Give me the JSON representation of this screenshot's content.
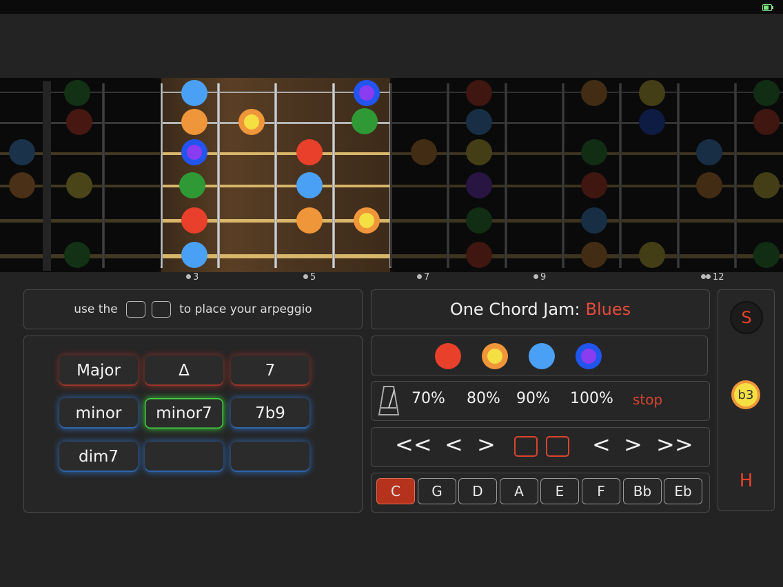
{
  "fret_numbers": [
    "3",
    "5",
    "7",
    "9",
    "12"
  ],
  "hint": {
    "prefix": "use the",
    "suffix": "to place your arpeggio"
  },
  "jam": {
    "title": "One Chord Jam:",
    "style": "Blues"
  },
  "chords": [
    "Major",
    "Δ",
    "7",
    "minor",
    "minor7",
    "7b9",
    "dim7",
    "",
    ""
  ],
  "speeds": [
    "70%",
    "80%",
    "90%",
    "100%",
    "stop"
  ],
  "nav": {
    "rewind": "<<",
    "prev": "<",
    "next": ">",
    "prev2": "<",
    "next2": ">",
    "forward": ">>"
  },
  "keys": [
    "C",
    "G",
    "D",
    "A",
    "E",
    "F",
    "Bb",
    "Eb"
  ],
  "selected_key": "C",
  "side": {
    "s": "S",
    "b3": "b3",
    "h": "H"
  },
  "colors": {
    "red": "#e8402a",
    "orange": "#f0963a",
    "yellow": "#f5e043",
    "blue": "#4aa0f5",
    "purple": "#8a3cf0",
    "green": "#2f9a35",
    "accent": "#d9442e"
  }
}
